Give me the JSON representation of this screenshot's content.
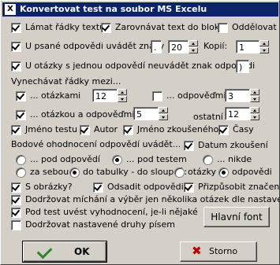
{
  "title": "Konvertovat test na soubor MS Excelu",
  "row1": {
    "lamat": "Lámat řádky textu",
    "zarovnavat": "Zarovnávat text do bloků",
    "oddelovat": "Oddělovat"
  },
  "row2": {
    "label": "U psané odpovědi uvádět znaky",
    "dot_value": ".",
    "znaky_value": "20",
    "kopii_label": "Kopií:",
    "kopii_value": "1"
  },
  "row3": {
    "label": "U otázky s jednou odpovědí neuvádět znak odpovědi",
    "znak_value": ")"
  },
  "vynechavat": {
    "heading": "Vynechávat řádky mezi...",
    "otazkami": "... otázkami",
    "otazkami_value": "12",
    "odpovedmi": "... odpověďmi",
    "odpovedmi_value": "3",
    "otazkou": "... otázkou a odpověďmi",
    "otazkou_value": "5",
    "ostatni": "ostatní",
    "ostatni_value": "12"
  },
  "jmeno": {
    "testu": "Jméno testu",
    "autor": "Autor",
    "zkousenehe": "Jméno zkoušeného",
    "casy": "Časy"
  },
  "bodove": {
    "heading": "Bodové ohodnocení odpovědí uvádět...",
    "datum": "Datum zkoušení",
    "pod_odpovedi": "... pod odpovědí",
    "pod_testem": "... pod testem",
    "nikde": "... nikde",
    "za_sebou": "za sebou",
    "do_tabulky": "do tabulky - do sloupců:",
    "otazky": "otázky",
    "odpovedi": "odpovědi"
  },
  "obrazky": {
    "s_obrazky": "S obrázky?",
    "odsadit": "Odsadit odpovědi",
    "prizpusobit": "Přizpůsobit značení"
  },
  "dodrzovat1": "Dodržovat míchání a výběr jen několika otázek dle nastavení",
  "pod_test": "Pod test uvést vyhodnocení, je-li nějaké",
  "dodrzovat2": "Dodržovat nastavené druhy písem",
  "hlavni_font": "Hlavní font",
  "ok": "OK",
  "storno": "Storno"
}
